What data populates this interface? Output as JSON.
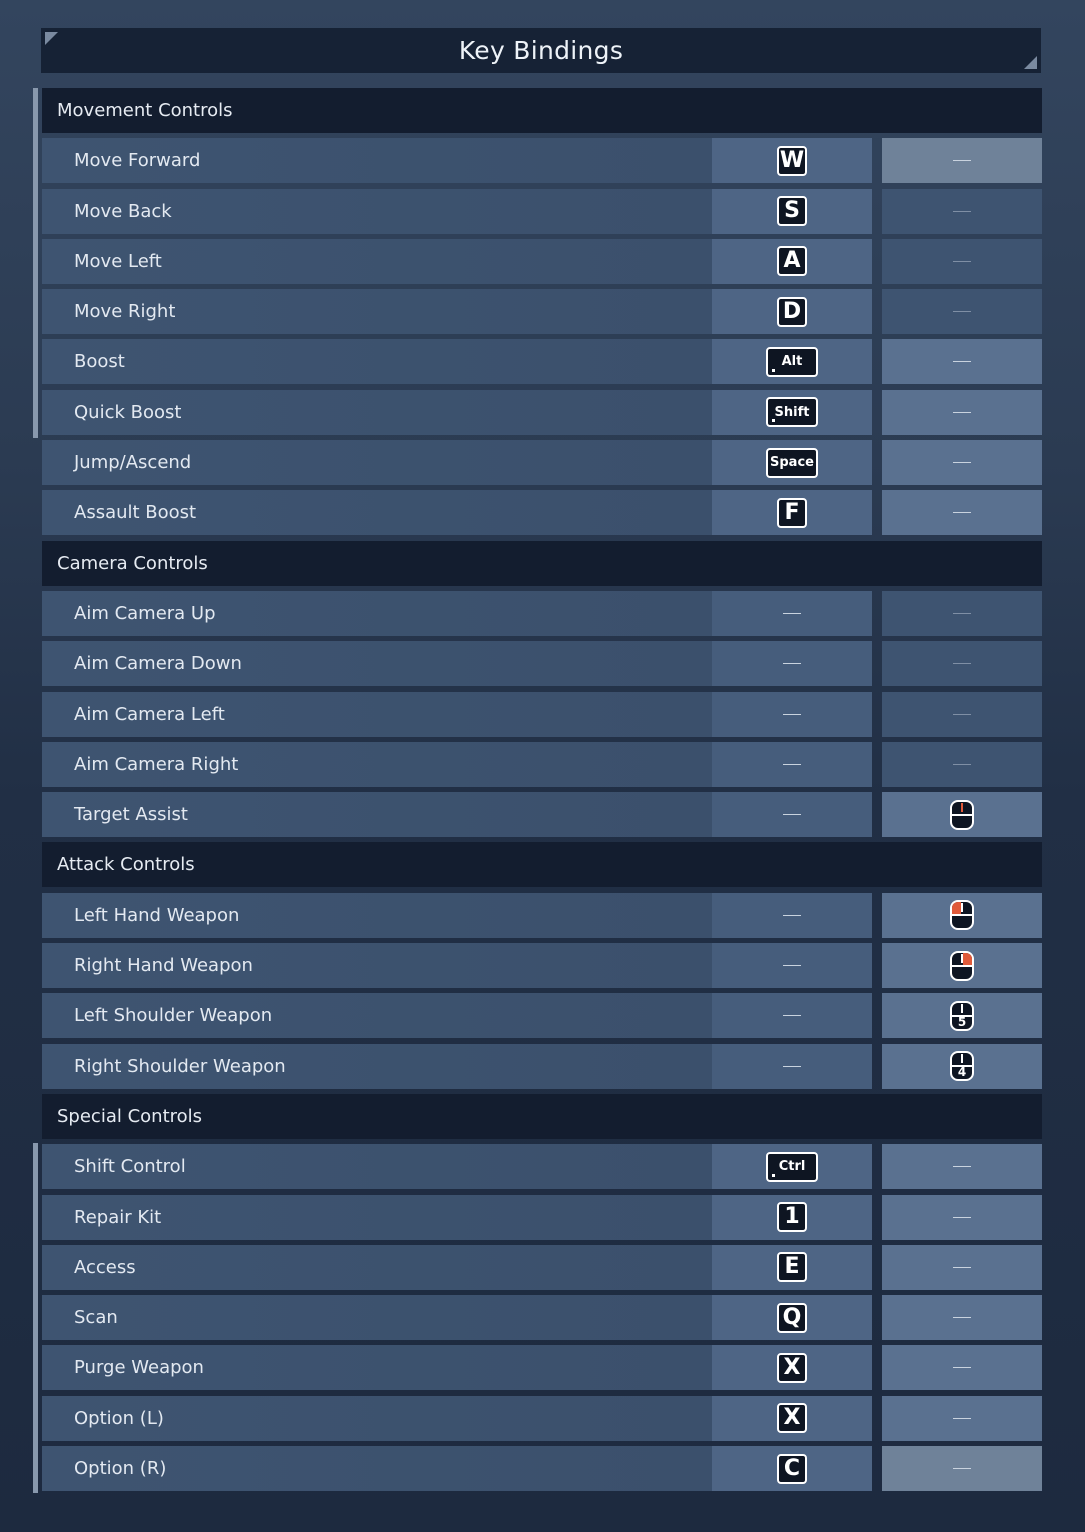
{
  "title": "Key Bindings",
  "sections": [
    {
      "name": "Movement Controls",
      "rows": [
        {
          "label": "Move Forward",
          "key": "W",
          "key_type": "letter",
          "alt": "—",
          "alt_style": "hl"
        },
        {
          "label": "Move Back",
          "key": "S",
          "key_type": "letter",
          "alt": "—",
          "alt_style": "dim"
        },
        {
          "label": "Move Left",
          "key": "A",
          "key_type": "letter",
          "alt": "—",
          "alt_style": "dim"
        },
        {
          "label": "Move Right",
          "key": "D",
          "key_type": "letter",
          "alt": "—",
          "alt_style": "dim"
        },
        {
          "label": "Boost",
          "key": "Alt",
          "key_type": "wide-dot",
          "alt": "—",
          "alt_style": "normal"
        },
        {
          "label": "Quick Boost",
          "key": "Shift",
          "key_type": "wide-dot",
          "alt": "—",
          "alt_style": "normal"
        },
        {
          "label": "Jump/Ascend",
          "key": "Space",
          "key_type": "wide",
          "alt": "—",
          "alt_style": "normal"
        },
        {
          "label": "Assault Boost",
          "key": "F",
          "key_type": "letter",
          "alt": "—",
          "alt_style": "normal"
        }
      ]
    },
    {
      "name": "Camera Controls",
      "rows": [
        {
          "label": "Aim Camera Up",
          "key": "—",
          "key_type": "dash",
          "alt": "—",
          "alt_style": "dim"
        },
        {
          "label": "Aim Camera Down",
          "key": "—",
          "key_type": "dash",
          "alt": "—",
          "alt_style": "dim"
        },
        {
          "label": "Aim Camera Left",
          "key": "—",
          "key_type": "dash",
          "alt": "—",
          "alt_style": "dim"
        },
        {
          "label": "Aim Camera Right",
          "key": "—",
          "key_type": "dash",
          "alt": "—",
          "alt_style": "dim"
        },
        {
          "label": "Target Assist",
          "key": "—",
          "key_type": "dash",
          "alt": "mouse-middle-click-icon",
          "alt_style": "normal"
        }
      ]
    },
    {
      "name": "Attack Controls",
      "rows": [
        {
          "label": "Left Hand Weapon",
          "key": "—",
          "key_type": "dash",
          "alt": "mouse-left-click-icon",
          "alt_style": "normal"
        },
        {
          "label": "Right Hand Weapon",
          "key": "—",
          "key_type": "dash",
          "alt": "mouse-right-click-icon",
          "alt_style": "normal"
        },
        {
          "label": "Left Shoulder Weapon",
          "key": "—",
          "key_type": "dash",
          "alt": "mouse-button-5-icon",
          "alt_num": "5",
          "alt_style": "normal"
        },
        {
          "label": "Right Shoulder Weapon",
          "key": "—",
          "key_type": "dash",
          "alt": "mouse-button-4-icon",
          "alt_num": "4",
          "alt_style": "normal"
        }
      ]
    },
    {
      "name": "Special Controls",
      "rows": [
        {
          "label": "Shift Control",
          "key": "Ctrl",
          "key_type": "wide-dot",
          "alt": "—",
          "alt_style": "normal"
        },
        {
          "label": "Repair Kit",
          "key": "1",
          "key_type": "letter",
          "alt": "—",
          "alt_style": "normal"
        },
        {
          "label": "Access",
          "key": "E",
          "key_type": "letter",
          "alt": "—",
          "alt_style": "normal"
        },
        {
          "label": "Scan",
          "key": "Q",
          "key_type": "letter",
          "alt": "—",
          "alt_style": "normal"
        },
        {
          "label": "Purge Weapon",
          "key": "X",
          "key_type": "letter",
          "alt": "—",
          "alt_style": "normal"
        },
        {
          "label": "Option (L)",
          "key": "X",
          "key_type": "letter",
          "alt": "—",
          "alt_style": "normal"
        },
        {
          "label": "Option (R)",
          "key": "C",
          "key_type": "letter",
          "alt": "—",
          "alt_style": "hl"
        }
      ]
    }
  ],
  "colors": {
    "mouse_highlight": "#e05a3a",
    "section_header_bg": "#131d2f",
    "row_bg": "#3e5471"
  }
}
